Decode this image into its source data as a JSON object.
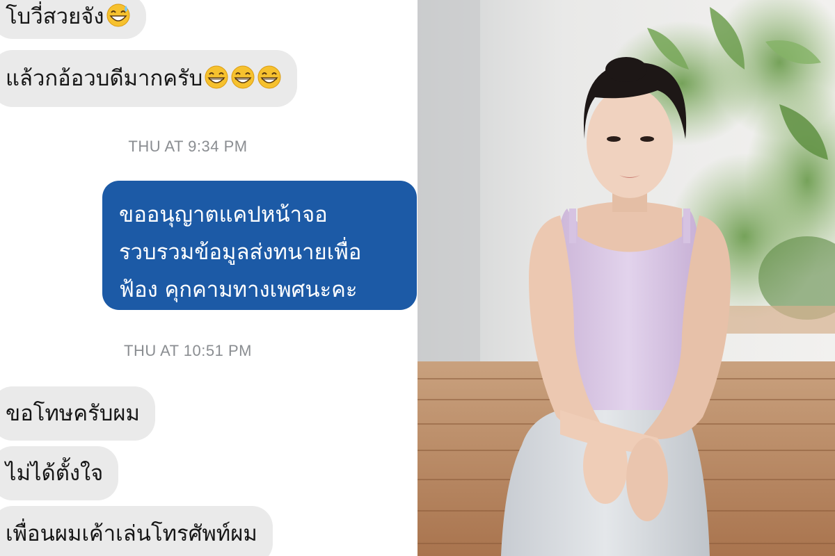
{
  "chat": {
    "messages_top": [
      {
        "text": "โบวี่สวยจัง",
        "emoji_count": 1
      },
      {
        "text": "แล้วกอ้อวบดีมากครับ",
        "emoji_count": 3
      }
    ],
    "timestamp_1": "THU AT 9:34 PM",
    "outgoing": {
      "line1": "ขออนุญาตแคปหน้าจอ",
      "line2": "รวบรวมข้อมูลส่งทนายเพื่อ",
      "line3": "ฟ้อง คุกคามทางเพศนะคะ"
    },
    "timestamp_2": "THU AT 10:51 PM",
    "messages_bottom": [
      {
        "text": "ขอโทษครับผม"
      },
      {
        "text": "ไม่ได้ตั้งใจ"
      },
      {
        "text": "เพื่อนผมเค้าเล่นโทรศัพท์ผม"
      }
    ]
  },
  "colors": {
    "incoming_bubble": "#eaeaea",
    "outgoing_bubble": "#1c5aa6",
    "timestamp_text": "#8a8d91"
  },
  "icons": {
    "emoji_sweat_smile": "grinning-face-with-sweat-icon",
    "emoji_grin": "beaming-face-icon"
  },
  "photo": {
    "subject": "woman-seated-on-wooden-deck"
  }
}
